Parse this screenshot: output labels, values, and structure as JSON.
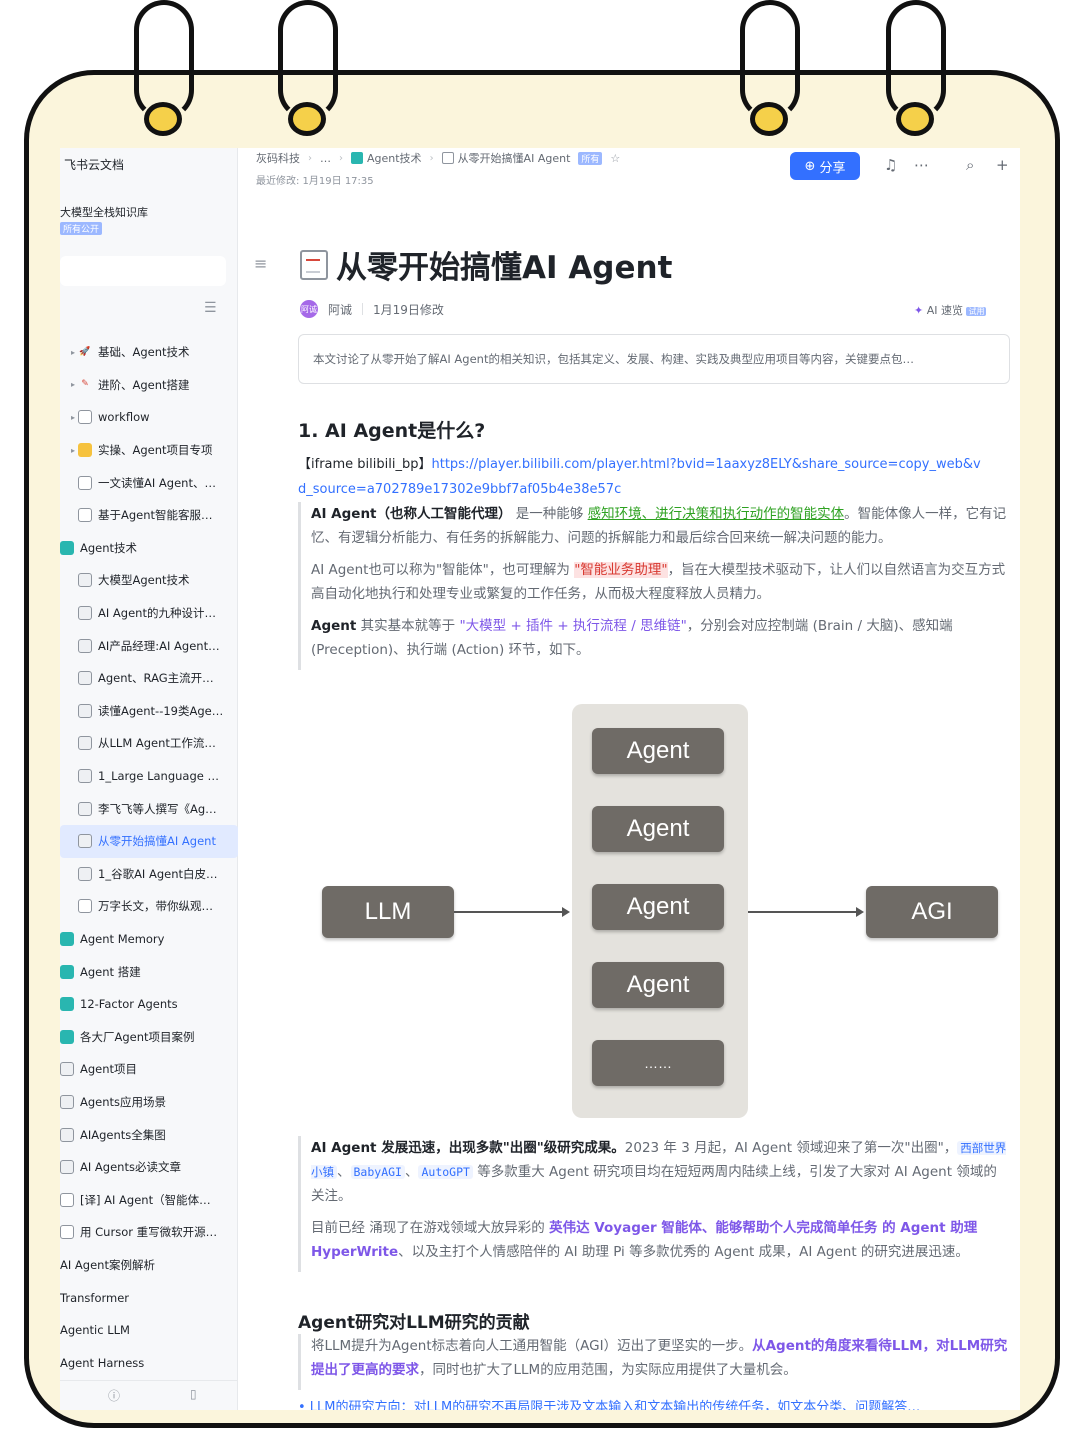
{
  "sidebar": {
    "brand": "飞书云文档",
    "knowledge_base": "大模型全栈知识库",
    "kb_tag": "所有公开",
    "items": [
      {
        "label": "基础、Agent技术",
        "icon": "rocket-emoji",
        "caret": true
      },
      {
        "label": "进阶、Agent搭建",
        "icon": "pencil-emoji",
        "caret": true
      },
      {
        "label": "workflow",
        "icon": "doc",
        "caret": true
      },
      {
        "label": "实操、Agent项目专项",
        "icon": "folder-yellow",
        "caret": true
      },
      {
        "label": "一文读懂AI Agent、…",
        "icon": "doc",
        "caret": false
      },
      {
        "label": "基于Agent智能客服…",
        "icon": "doc",
        "caret": false
      },
      {
        "label": "Agent技术",
        "icon": "folder-teal",
        "caret": false
      },
      {
        "label": "大模型Agent技术",
        "icon": "sheet",
        "caret": false
      },
      {
        "label": "AI Agent的九种设计…",
        "icon": "sheet",
        "caret": false
      },
      {
        "label": "AI产品经理:AI Agent…",
        "icon": "sheet",
        "caret": false
      },
      {
        "label": "Agent、RAG主流开…",
        "icon": "sheet",
        "caret": false
      },
      {
        "label": "读懂Agent--19类Age…",
        "icon": "sheet",
        "caret": false
      },
      {
        "label": "从LLM Agent工作流…",
        "icon": "sheet",
        "caret": false
      },
      {
        "label": "1_Large Language …",
        "icon": "sheet",
        "caret": false
      },
      {
        "label": "李飞飞等人撰写《Ag…",
        "icon": "sheet",
        "caret": false
      },
      {
        "label": "从零开始搞懂AI Agent",
        "icon": "sheet",
        "caret": false,
        "active": true
      },
      {
        "label": "1_谷歌AI Agent白皮…",
        "icon": "sheet",
        "caret": false
      },
      {
        "label": "万字长文，带你纵观…",
        "icon": "doc",
        "caret": false
      },
      {
        "label": "Agent Memory",
        "icon": "folder-teal",
        "caret": false
      },
      {
        "label": "Agent 搭建",
        "icon": "folder-teal",
        "caret": false
      },
      {
        "label": "12-Factor Agents",
        "icon": "folder-teal",
        "caret": false
      },
      {
        "label": "各大厂Agent项目案例",
        "icon": "folder-teal",
        "caret": false
      },
      {
        "label": "Agent项目",
        "icon": "sheet",
        "caret": false
      },
      {
        "label": "Agents应用场景",
        "icon": "sheet",
        "caret": false
      },
      {
        "label": "AIAgents全集图",
        "icon": "sheet",
        "caret": false
      },
      {
        "label": "AI Agents必读文章",
        "icon": "sheet",
        "caret": false
      },
      {
        "label": "[译] AI Agent（智能体…",
        "icon": "doc",
        "caret": false
      },
      {
        "label": "用 Cursor 重写微软开源…",
        "icon": "doc",
        "caret": false
      },
      {
        "label": "AI Agent案例解析",
        "icon": "none",
        "caret": false
      },
      {
        "label": "Transformer",
        "icon": "none",
        "caret": false
      },
      {
        "label": "Agentic LLM",
        "icon": "none",
        "caret": false
      },
      {
        "label": "Agent Harness",
        "icon": "none",
        "caret": false
      }
    ],
    "footer_left": "ⓘ",
    "footer_right": "▯"
  },
  "topbar": {
    "crumbs": [
      "灰码科技",
      "…",
      "Agent技术",
      "从零开始搞懂AI Agent"
    ],
    "crumb_tag": "所有",
    "last_modified": "最近修改: 1月19日 17:35",
    "share_label": "分享"
  },
  "doc": {
    "title": "从零开始搞懂AI Agent",
    "author": "阿诚",
    "avatar_text": "阿诚",
    "modified": "1月19日修改",
    "ai_read": "AI 速览",
    "ai_tag": "试用",
    "summary": "本文讨论了从零开始了解AI Agent的相关知识，包括其定义、发展、构建、实践及典型应用项目等内容，关键要点包…",
    "h1": "1. AI Agent是什么?",
    "iframe_prefix": "【iframe bilibili_bp】",
    "iframe_url": "https://player.bilibili.com/player.html?bvid=1aaxyz8ELY&share_source=copy_web&vd_source=a702789e17302e9bbf7af05b4e38e57c",
    "p1a": "AI Agent（也称人工智能代理）",
    "p1b": " 是一种能够 ",
    "p1c": "感知环境、进行决策和执行动作的智能实体",
    "p1d": "。智能体像人一样，它有记忆、有逻辑分析能力、有任务的拆解能力、问题的拆解能力和最后综合回来统一解决问题的能力。",
    "p2a": "AI Agent也可以称为\"智能体\"，也可理解为 ",
    "p2b": "\"智能业务助理\"",
    "p2c": "，旨在大模型技术驱动下，让人们以自然语言为交互方式高自动化地执行和处理专业或繁复的工作任务，从而极大程度释放人员精力。",
    "p3a": "Agent",
    "p3b": " 其实基本就等于 ",
    "p3c": "\"大模型 + 插件 + 执行流程 / 思维链\"",
    "p3d": "，分别会对应控制端 (Brain / 大脑)、感知端 (Preception)、执行端 (Action) 环节，如下。",
    "p4a": "AI Agent 发展迅速，出现多款\"出圈\"级研究成果。",
    "p4b": "2023 年 3 月起，AI Agent 领域迎来了第一次\"出圈\"，",
    "p4c": "西部世界小镇",
    "p4d": "BabyAGI",
    "p4e": "AutoGPT",
    "p4f": " 等多款重大 Agent 研究项目均在短短两周内陆续上线，引发了大家对 AI Agent 领域的关注。",
    "p5a": "目前已经 涌现了在游戏领域大放异彩的 ",
    "p5b": "英伟达 Voyager 智能体、能够帮助个人完成简单任务 的 Agent 助理 HyperWrite",
    "p5c": "、以及主打个人情感陪伴的 AI 助理 Pi 等多款优秀的 Agent 成果，AI Agent 的研究进展迅速。",
    "h2": "Agent研究对LLM研究的贡献",
    "p6a": "将LLM提升为Agent标志着向人工通用智能（AGI）迈出了更坚实的一步。",
    "p6b": "从Agent的角度来看待LLM，对LLM研究提出了更高的要求",
    "p6c": "，同时也扩大了LLM的应用范围，为实际应用提供了大量机会。",
    "bullet": "• LLM的研究方向：对LLM的研究不再局限于涉及文本输入和文本输出的传统任务，如文本分类、问题解答…"
  },
  "diagram": {
    "left": "LLM",
    "right": "AGI",
    "agents": [
      "Agent",
      "Agent",
      "Agent",
      "Agent",
      "……"
    ]
  }
}
